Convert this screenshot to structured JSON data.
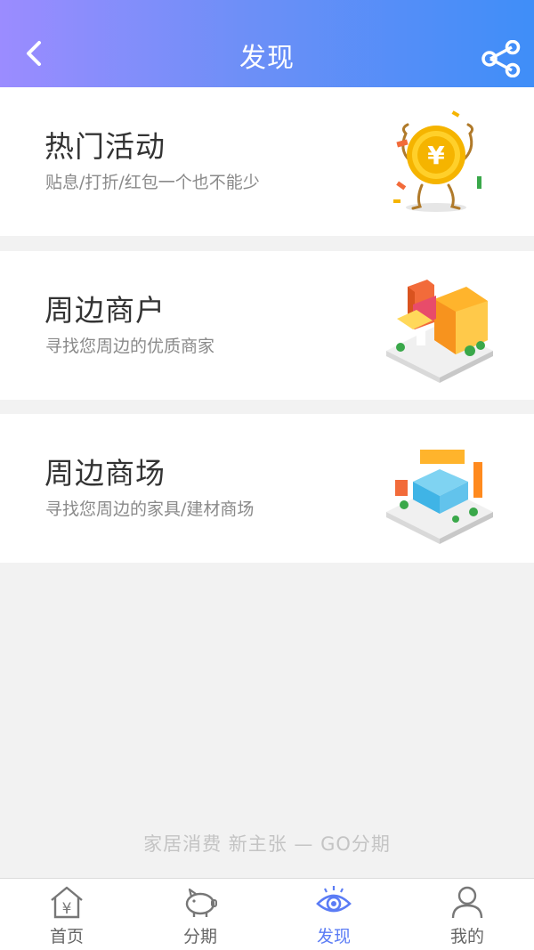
{
  "header": {
    "title": "发现",
    "back_icon": "chevron-left-icon",
    "share_icon": "share-icon"
  },
  "cards": [
    {
      "title": "热门活动",
      "subtitle": "贴息/打折/红包一个也不能少",
      "illustration": "coin-mascot-illustration"
    },
    {
      "title": "周边商户",
      "subtitle": "寻找您周边的优质商家",
      "illustration": "shop-building-illustration"
    },
    {
      "title": "周边商场",
      "subtitle": "寻找您周边的家具/建材商场",
      "illustration": "mall-building-illustration"
    }
  ],
  "slogan": "家居消费 新主张 — GO分期",
  "tabbar": {
    "items": [
      {
        "label": "首页",
        "icon": "home-yen-icon"
      },
      {
        "label": "分期",
        "icon": "piggy-bank-icon"
      },
      {
        "label": "发现",
        "icon": "eye-icon",
        "active": true
      },
      {
        "label": "我的",
        "icon": "user-icon"
      }
    ]
  },
  "colors": {
    "header_gradient_start": "#9b8cff",
    "header_gradient_end": "#3f8ef8",
    "active_tab": "#5b7cf5",
    "background": "#f2f2f2"
  }
}
